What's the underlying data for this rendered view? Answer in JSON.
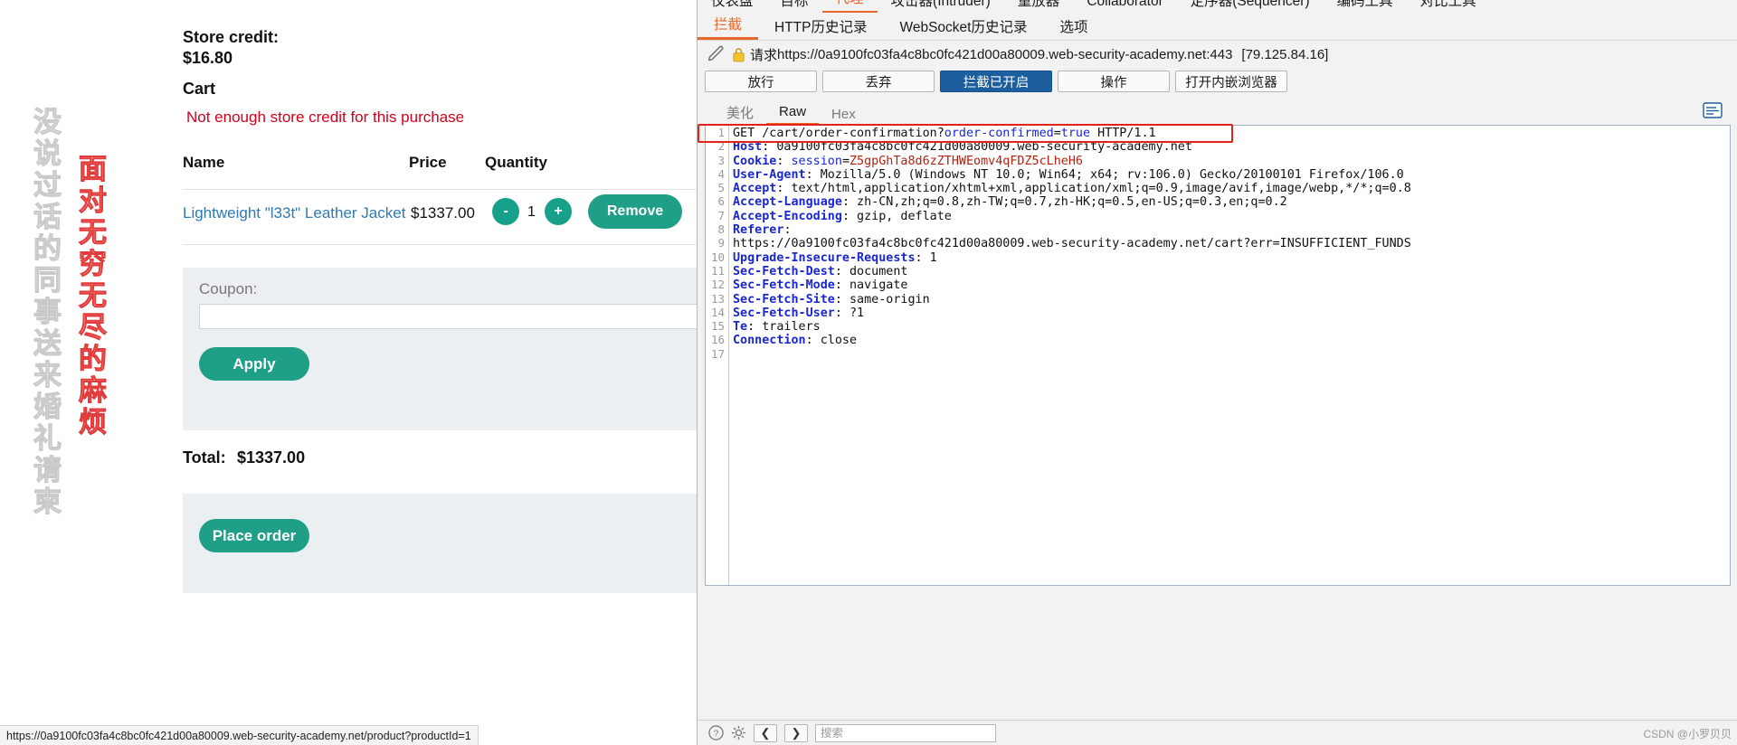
{
  "browser": {
    "watermark_gray": "没说过话的同事送来婚礼请柬",
    "watermark_red": "面对无穷无尽的麻烦",
    "store_credit_label": "Store credit:",
    "store_credit_value": "$16.80",
    "cart_heading": "Cart",
    "error_message": "Not enough store credit for this purchase",
    "columns": {
      "name": "Name",
      "price": "Price",
      "quantity": "Quantity"
    },
    "items": [
      {
        "name": "Lightweight \"l33t\" Leather Jacket",
        "price": "$1337.00",
        "minus": "-",
        "qty": "1",
        "plus": "+",
        "remove": "Remove"
      }
    ],
    "coupon_label": "Coupon:",
    "coupon_value": "",
    "apply_label": "Apply",
    "total_label": "Total:",
    "total_value": "$1337.00",
    "place_order_label": "Place order",
    "status_url": "https://0a9100fc03fa4c8bc0fc421d00a80009.web-security-academy.net/product?productId=1"
  },
  "burp": {
    "top_tabs": [
      {
        "label": "仪表盘",
        "active": false
      },
      {
        "label": "目标",
        "active": false
      },
      {
        "label": "代理",
        "active": true
      },
      {
        "label": "攻击器(Intruder)",
        "active": false
      },
      {
        "label": "重放器",
        "active": false
      },
      {
        "label": "Collaborator",
        "active": false
      },
      {
        "label": "定序器(Sequencer)",
        "active": false
      },
      {
        "label": "编码工具",
        "active": false
      },
      {
        "label": "对比工具",
        "active": false
      }
    ],
    "sub_tabs": [
      {
        "label": "拦截",
        "active": true
      },
      {
        "label": "HTTP历史记录",
        "active": false
      },
      {
        "label": "WebSocket历史记录",
        "active": false
      },
      {
        "label": "选项",
        "active": false
      }
    ],
    "request_prefix": "请求",
    "request_url": "https://0a9100fc03fa4c8bc0fc421d00a80009.web-security-academy.net:443",
    "request_ip": "[79.125.84.16]",
    "buttons": [
      {
        "label": "放行",
        "primary": false
      },
      {
        "label": "丢弃",
        "primary": false
      },
      {
        "label": "拦截已开启",
        "primary": true
      },
      {
        "label": "操作",
        "primary": false
      },
      {
        "label": "打开内嵌浏览器",
        "primary": false
      }
    ],
    "editor_tabs": [
      {
        "label": "美化",
        "active": false
      },
      {
        "label": "Raw",
        "active": true
      },
      {
        "label": "Hex",
        "active": false
      }
    ],
    "request_lines": [
      {
        "n": "1",
        "segments": [
          {
            "t": "GET /cart/order-confirmation?",
            "c": "v"
          },
          {
            "t": "order-confirmed",
            "c": "blue"
          },
          {
            "t": "=",
            "c": "v"
          },
          {
            "t": "true",
            "c": "blue"
          },
          {
            "t": " HTTP/1.1",
            "c": "v"
          }
        ],
        "highlight": true
      },
      {
        "n": "2",
        "segments": [
          {
            "t": "Host",
            "c": "k"
          },
          {
            "t": ": 0a9100fc03fa4c8bc0fc421d00a80009.web-security-academy.net",
            "c": "v"
          }
        ]
      },
      {
        "n": "3",
        "segments": [
          {
            "t": "Cookie",
            "c": "k"
          },
          {
            "t": ": ",
            "c": "v"
          },
          {
            "t": "session",
            "c": "blue"
          },
          {
            "t": "=",
            "c": "v"
          },
          {
            "t": "Z5gpGhTa8d6zZTHWEomv4qFDZ5cLheH6",
            "c": "red"
          }
        ]
      },
      {
        "n": "4",
        "segments": [
          {
            "t": "User-Agent",
            "c": "k"
          },
          {
            "t": ": Mozilla/5.0 (Windows NT 10.0; Win64; x64; rv:106.0) Gecko/20100101 Firefox/106.0",
            "c": "v"
          }
        ]
      },
      {
        "n": "5",
        "segments": [
          {
            "t": "Accept",
            "c": "k"
          },
          {
            "t": ": text/html,application/xhtml+xml,application/xml;q=0.9,image/avif,image/webp,*/*;q=0.8",
            "c": "v"
          }
        ]
      },
      {
        "n": "6",
        "segments": [
          {
            "t": "Accept-Language",
            "c": "k"
          },
          {
            "t": ": zh-CN,zh;q=0.8,zh-TW;q=0.7,zh-HK;q=0.5,en-US;q=0.3,en;q=0.2",
            "c": "v"
          }
        ]
      },
      {
        "n": "7",
        "segments": [
          {
            "t": "Accept-Encoding",
            "c": "k"
          },
          {
            "t": ": gzip, deflate",
            "c": "v"
          }
        ]
      },
      {
        "n": "8",
        "segments": [
          {
            "t": "Referer",
            "c": "k"
          },
          {
            "t": ":",
            "c": "v"
          }
        ]
      },
      {
        "n": "",
        "segments": [
          {
            "t": "https://0a9100fc03fa4c8bc0fc421d00a80009.web-security-academy.net/cart?err=INSUFFICIENT_FUNDS",
            "c": "v"
          }
        ]
      },
      {
        "n": "9",
        "segments": [
          {
            "t": "Upgrade-Insecure-Requests",
            "c": "k"
          },
          {
            "t": ": 1",
            "c": "v"
          }
        ]
      },
      {
        "n": "10",
        "segments": [
          {
            "t": "Sec-Fetch-Dest",
            "c": "k"
          },
          {
            "t": ": document",
            "c": "v"
          }
        ]
      },
      {
        "n": "11",
        "segments": [
          {
            "t": "Sec-Fetch-Mode",
            "c": "k"
          },
          {
            "t": ": navigate",
            "c": "v"
          }
        ]
      },
      {
        "n": "12",
        "segments": [
          {
            "t": "Sec-Fetch-Site",
            "c": "k"
          },
          {
            "t": ": same-origin",
            "c": "v"
          }
        ]
      },
      {
        "n": "13",
        "segments": [
          {
            "t": "Sec-Fetch-User",
            "c": "k"
          },
          {
            "t": ": ?1",
            "c": "v"
          }
        ]
      },
      {
        "n": "14",
        "segments": [
          {
            "t": "Te",
            "c": "k"
          },
          {
            "t": ": trailers",
            "c": "v"
          }
        ]
      },
      {
        "n": "15",
        "segments": [
          {
            "t": "Connection",
            "c": "k"
          },
          {
            "t": ": close",
            "c": "v"
          }
        ]
      },
      {
        "n": "16",
        "segments": []
      },
      {
        "n": "17",
        "segments": []
      }
    ],
    "search_placeholder": "搜索"
  },
  "watermark_credit": "CSDN @小罗贝贝",
  "colors": {
    "accent_orange": "#e8682c",
    "primary_blue": "#1c5e9e",
    "teal": "#1f9e88",
    "error_red": "#d0021b",
    "highlight_red": "#e3221b",
    "link_blue": "#2c7ab8"
  }
}
